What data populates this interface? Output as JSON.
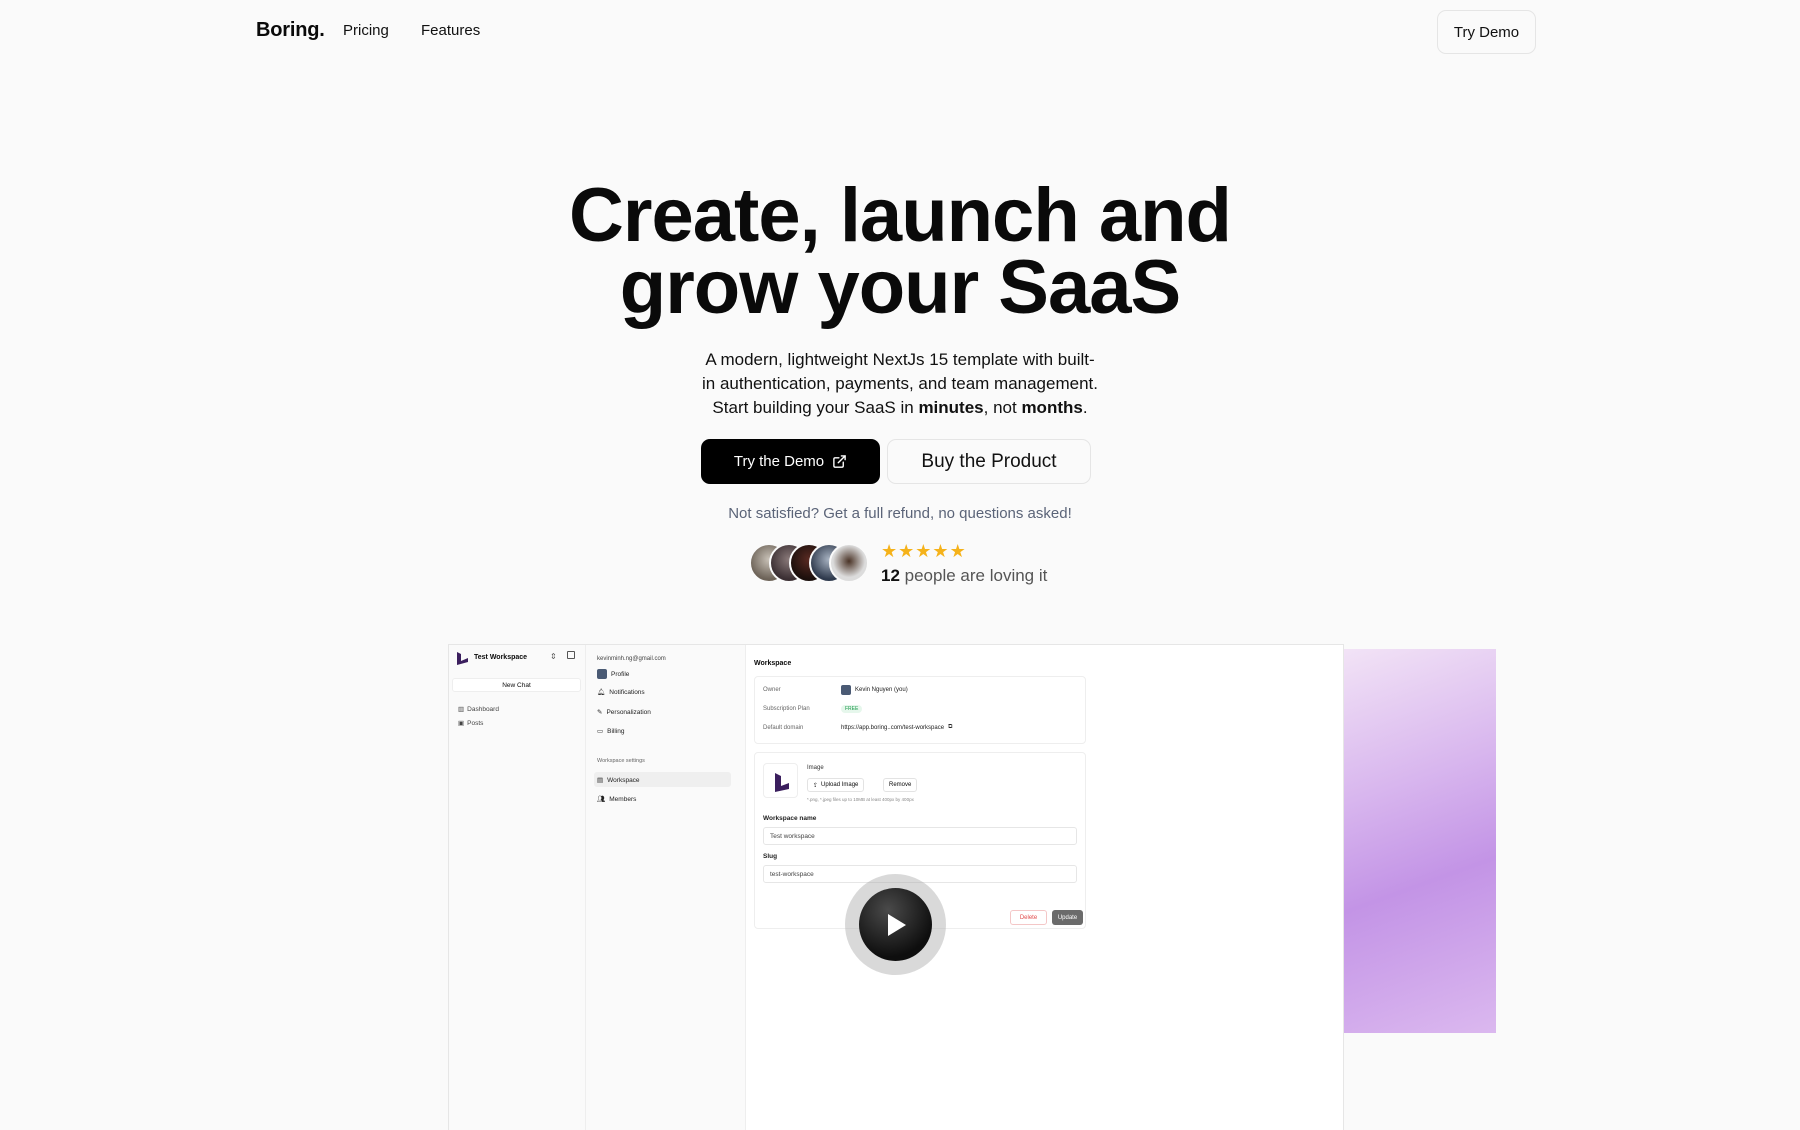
{
  "nav": {
    "brand": "Boring.",
    "links": [
      "Pricing",
      "Features"
    ],
    "cta": "Try Demo"
  },
  "hero": {
    "title_line1": "Create, launch and",
    "title_line2": "grow your SaaS",
    "sub_line1": "A modern, lightweight NextJs 15 template with built-",
    "sub_line2": "in authentication, payments, and team management.",
    "sub_line3_pre": "Start building your SaaS in ",
    "sub_line3_bold1": "minutes",
    "sub_line3_mid": ", not ",
    "sub_line3_bold2": "months",
    "sub_line3_end": ".",
    "primary_cta": "Try the Demo",
    "secondary_cta": "Buy the Product",
    "refund_note": "Not satisfied? Get a full refund, no questions asked!",
    "rating_stars": 5,
    "loving_count": "12",
    "loving_text": " people are loving it"
  },
  "preview": {
    "workspace_name": "Test Workspace",
    "new_chat": "New Chat",
    "sidebar_items": [
      "Dashboard",
      "Posts"
    ],
    "email": "kevinminh.ng@gmail.com",
    "settings_items": [
      "Profile",
      "Notifications",
      "Personalization",
      "Billing"
    ],
    "workspace_settings_label": "Workspace settings",
    "workspace_settings_items": [
      "Workspace",
      "Members"
    ],
    "heading": "Workspace",
    "owner_label": "Owner",
    "owner_value": "Kevin Nguyen (you)",
    "plan_label": "Subscription Plan",
    "plan_value": "FREE",
    "domain_label": "Default domain",
    "domain_value": "https://app.boring..com/test-workspace",
    "image_label": "Image",
    "upload_label": "Upload Image",
    "remove_label": "Remove",
    "image_hint": "*.png, *.jpeg files up to 10MB at least 400px by 400px",
    "name_label": "Workspace name",
    "name_value": "Test workspace",
    "slug_label": "Slug",
    "slug_value": "test-workspace",
    "delete_label": "Delete",
    "update_label": "Update"
  },
  "colors": {
    "accent_star": "#f5b21a",
    "primary_button": "#000000",
    "glow": "#c394e6"
  }
}
